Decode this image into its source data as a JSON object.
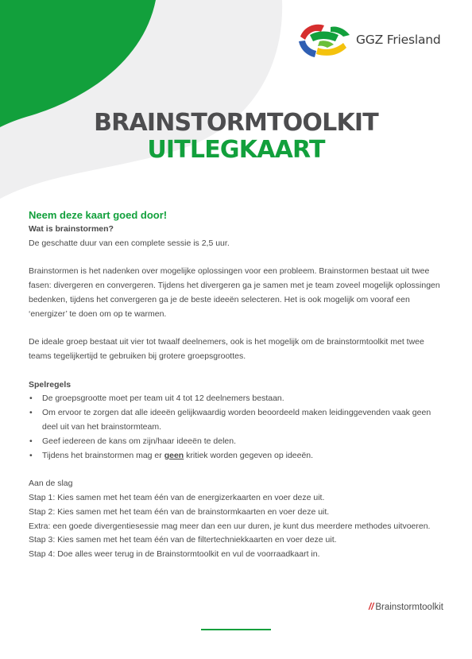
{
  "colors": {
    "green": "#12a03c",
    "gray_shape": "#efeff0",
    "dark_text": "#4d4d4f"
  },
  "logo": {
    "text": "GGZ Friesland"
  },
  "title": {
    "line1": "BRAINSTORMTOOLKIT",
    "line2": "UITLEGKAART"
  },
  "intro": "Neem deze kaart goed door!",
  "what": {
    "heading": "Wat is brainstormen?",
    "duration": "De geschatte duur van een complete sessie is 2,5 uur.",
    "para1": "Brainstormen is het nadenken over mogelijke oplossingen voor een probleem. Brainstormen bestaat uit twee fasen: divergeren en convergeren. Tijdens het divergeren ga je samen met je team zoveel mogelijk oplossingen bedenken, tijdens het convergeren ga je de beste ideeën selecteren. Het is ook mogelijk om vooraf een ‘energizer’ te doen om op te warmen.",
    "para2": "De ideale groep bestaat uit vier tot twaalf deelnemers, ook is het mogelijk om de brainstormtoolkit met twee teams tegelijkertijd te gebruiken bij grotere groepsgroottes."
  },
  "rules": {
    "heading": "Spelregels",
    "item1": "De groepsgrootte moet per team uit 4 tot 12 deelnemers bestaan.",
    "item2": "Om ervoor te zorgen dat alle ideeën gelijkwaardig worden beoordeeld maken leidinggevenden vaak geen deel uit van het brainstormteam.",
    "item3": "Geef iedereen de kans om zijn/haar ideeën te delen.",
    "item4_before": "Tijdens het brainstormen mag er ",
    "item4_emph": "geen",
    "item4_after": " kritiek worden gegeven op ideeën."
  },
  "steps": {
    "heading": "Aan de slag",
    "lines": [
      "Stap 1: Kies samen met het team één van de energizerkaarten en voer deze uit.",
      "Stap 2: Kies samen met het team één van de brainstormkaarten en voer deze uit.",
      "Extra: een goede divergentiesessie mag meer dan een uur duren, je kunt dus meerdere methodes uitvoeren.",
      "Stap 3: Kies samen met het team één van de filtertechniekkaarten en voer deze uit.",
      "Stap 4: Doe alles weer terug in de Brainstormtoolkit en vul de voorraadkaart in."
    ]
  },
  "footer": {
    "slashes": "//",
    "brand": "Brainstormtoolkit"
  }
}
